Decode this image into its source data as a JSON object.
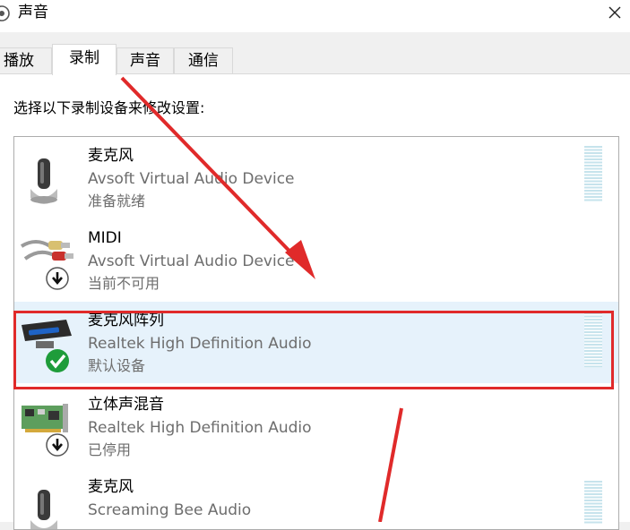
{
  "window": {
    "title": "声音"
  },
  "tabs": [
    {
      "label": "播放",
      "active": false
    },
    {
      "label": "录制",
      "active": true
    },
    {
      "label": "声音",
      "active": false
    },
    {
      "label": "通信",
      "active": false
    }
  ],
  "instruction": "选择以下录制设备来修改设置:",
  "devices": [
    {
      "name": "麦克风",
      "driver": "Avsoft Virtual Audio Device",
      "status": "准备就绪",
      "icon": "microphone-icon",
      "badge": "none"
    },
    {
      "name": "MIDI",
      "driver": "Avsoft Virtual Audio Device",
      "status": "当前不可用",
      "icon": "rca-cable-icon",
      "badge": "down-arrow-badge"
    },
    {
      "name": "麦克风阵列",
      "driver": "Realtek High Definition Audio",
      "status": "默认设备",
      "icon": "microphone-array-icon",
      "badge": "green-check-badge",
      "selected": true
    },
    {
      "name": "立体声混音",
      "driver": "Realtek High Definition Audio",
      "status": "已停用",
      "icon": "sound-card-icon",
      "badge": "down-arrow-badge"
    },
    {
      "name": "麦克风",
      "driver": "Screaming Bee Audio",
      "status": "",
      "icon": "microphone-icon",
      "badge": "none"
    }
  ],
  "colors": {
    "selection_bg": "#e6f2fb",
    "annotation_red": "#e02a2a",
    "meter": "#c6e3ec",
    "default_check": "#1e9c3a"
  }
}
